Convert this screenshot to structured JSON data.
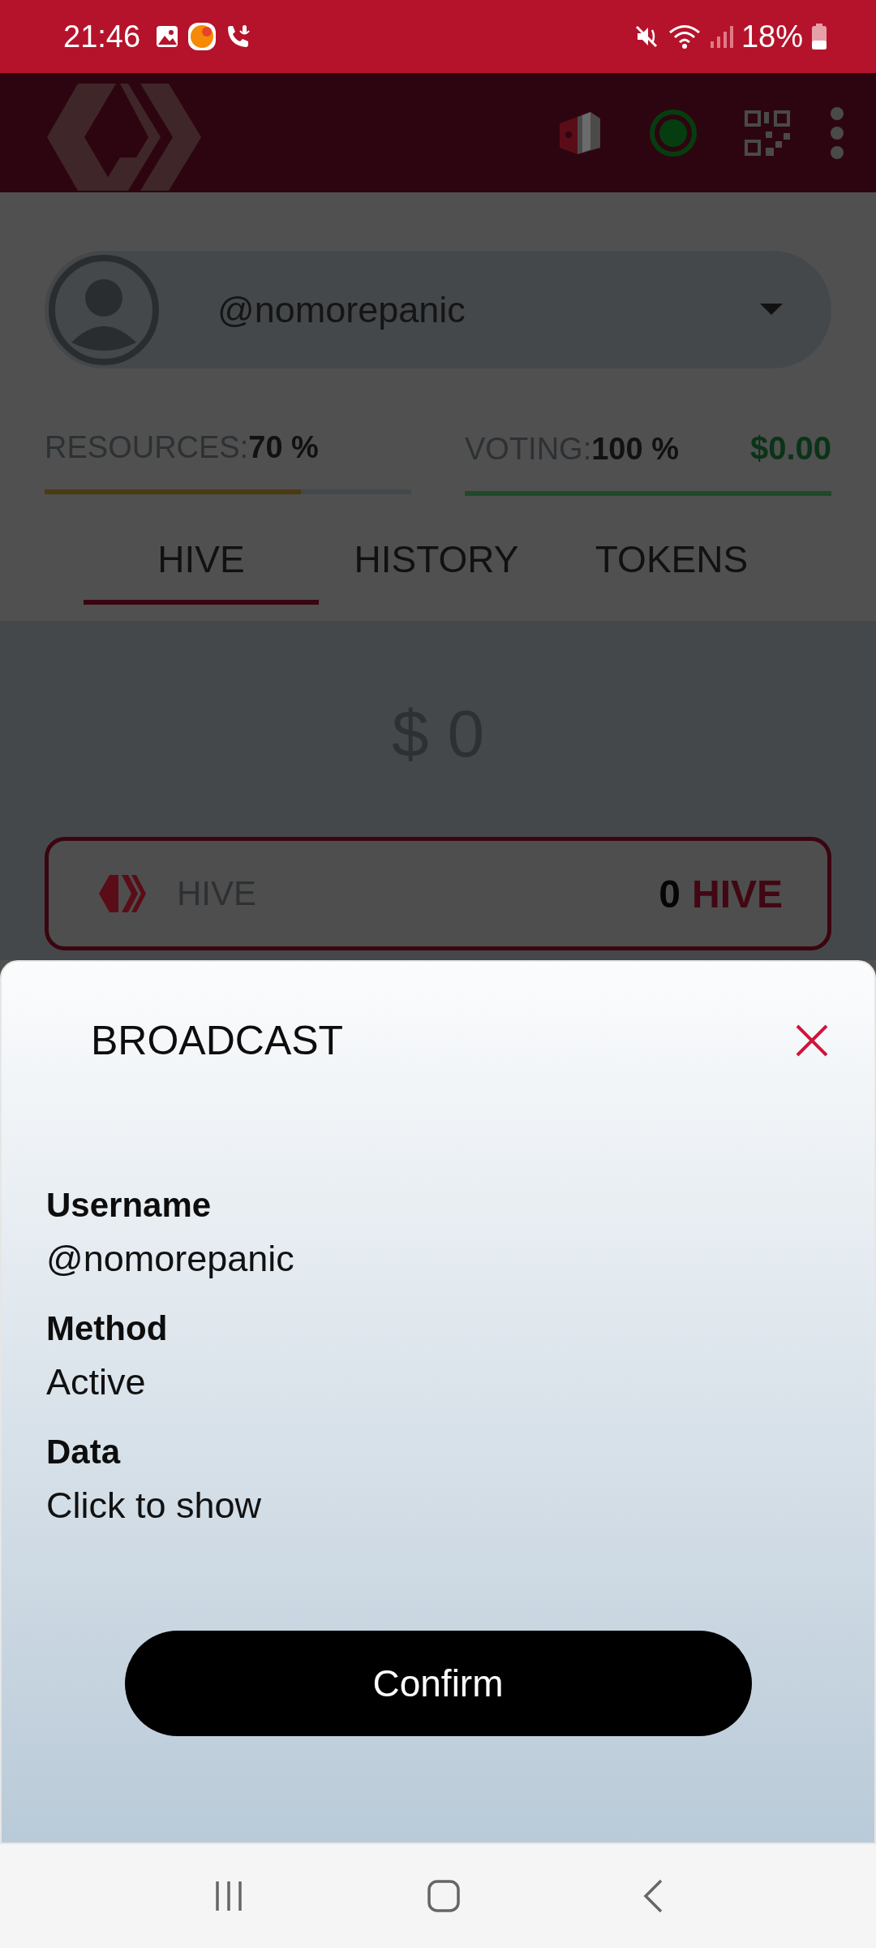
{
  "status_bar": {
    "time": "21:46",
    "battery": "18%"
  },
  "account": {
    "username": "@nomorepanic"
  },
  "meters": [
    {
      "label": "RESOURCES:",
      "value": "70 %",
      "level": 0.7,
      "color": "#4a3a10"
    },
    {
      "label": "VOTING:",
      "value": "100 %",
      "level": 1.0,
      "color": "#1f4a2a"
    }
  ],
  "vote_value": "$0.00",
  "tabs": [
    {
      "label": "HIVE",
      "selected": true
    },
    {
      "label": "HISTORY",
      "selected": false
    },
    {
      "label": "TOKENS",
      "selected": false
    }
  ],
  "balance": "$ 0",
  "token_card": {
    "name": "HIVE",
    "amount": "0",
    "unit": "HIVE"
  },
  "dialog": {
    "title": "BROADCAST",
    "fields": [
      {
        "label": "Username",
        "value": "@nomorepanic"
      },
      {
        "label": "Method",
        "value": "Active"
      },
      {
        "label": "Data",
        "value": "Click to show"
      }
    ],
    "button": "Confirm"
  }
}
